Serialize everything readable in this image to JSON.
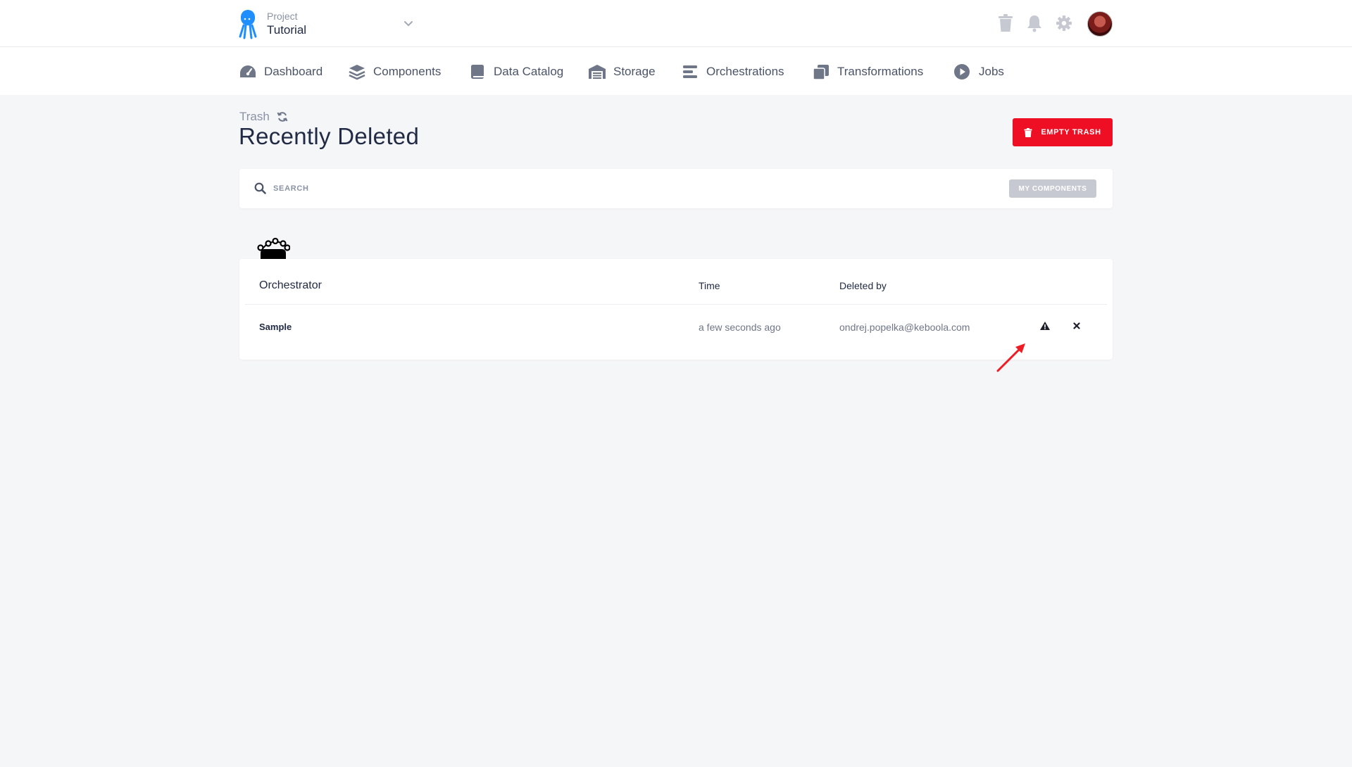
{
  "header": {
    "project_label": "Project",
    "project_name": "Tutorial"
  },
  "nav": {
    "items": [
      {
        "label": "Dashboard",
        "icon": "dashboard-icon"
      },
      {
        "label": "Components",
        "icon": "layers-icon"
      },
      {
        "label": "Data Catalog",
        "icon": "book-icon"
      },
      {
        "label": "Storage",
        "icon": "warehouse-icon"
      },
      {
        "label": "Orchestrations",
        "icon": "bars-icon"
      },
      {
        "label": "Transformations",
        "icon": "copy-icon"
      },
      {
        "label": "Jobs",
        "icon": "play-circle-icon"
      }
    ]
  },
  "page": {
    "breadcrumb": "Trash",
    "title": "Recently Deleted",
    "empty_trash_label": "EMPTY TRASH"
  },
  "search": {
    "placeholder": "SEARCH",
    "filter_label": "MY COMPONENTS"
  },
  "table": {
    "component_icon": "orchestrator-icon",
    "headers": {
      "name": "Orchestrator",
      "time": "Time",
      "deleted_by": "Deleted by"
    },
    "rows": [
      {
        "name": "Sample",
        "time": "a few seconds ago",
        "deleted_by": "ondrej.popelka@keboola.com"
      }
    ]
  },
  "colors": {
    "accent_red": "#ee0f24",
    "brand_blue": "#1f8fff",
    "muted_button": "#c6c9d2",
    "background": "#f5f6f8"
  }
}
